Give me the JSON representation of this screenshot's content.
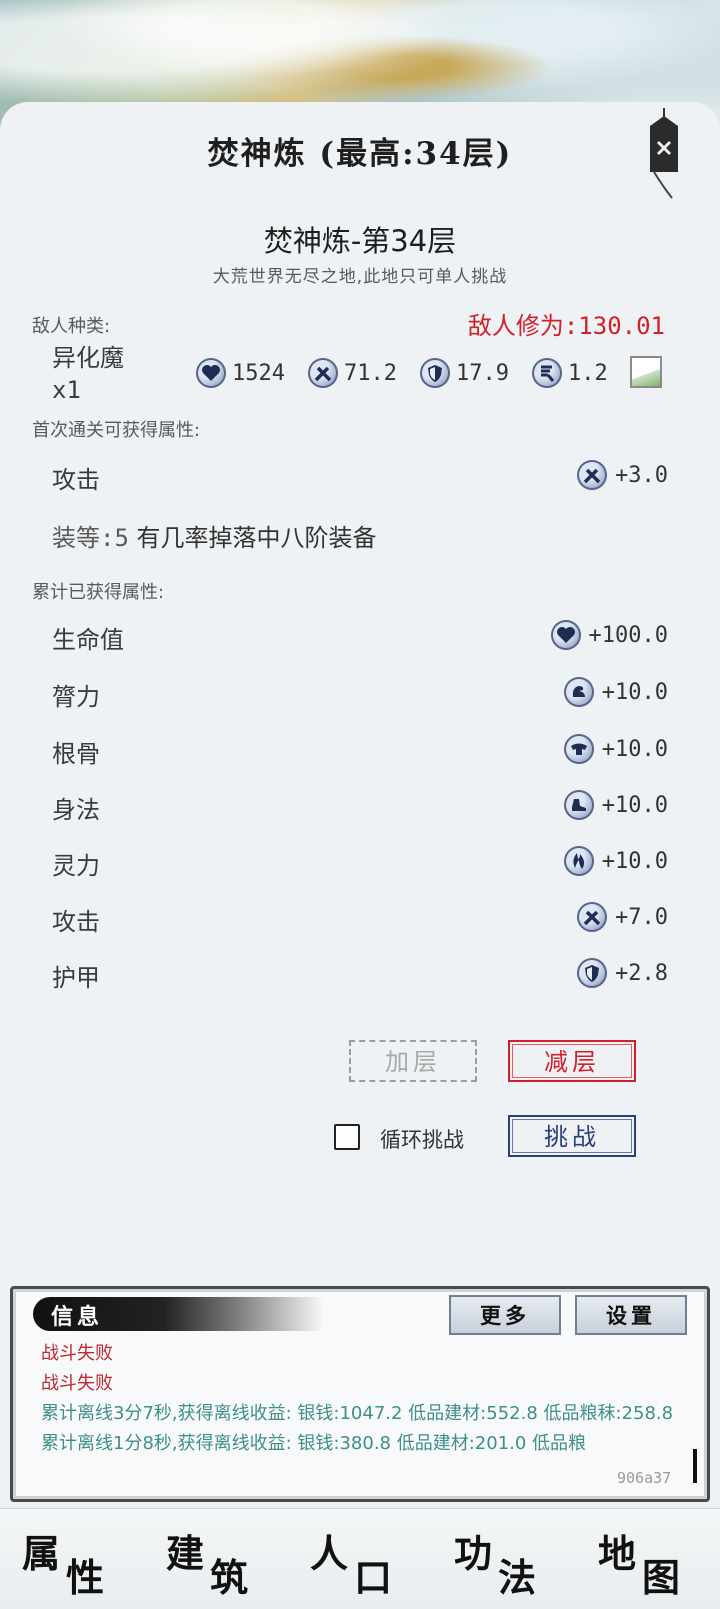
{
  "header": {
    "title": "焚神炼 (最高:34层)"
  },
  "stage": {
    "title": "焚神炼-第34层",
    "subtitle": "大荒世界无尽之地,此地只可单人挑战"
  },
  "enemy": {
    "type_label": "敌人种类:",
    "cultivation": "敌人修为:130.01",
    "name": "异化魔",
    "count": "x1",
    "stats": [
      {
        "icon": "heart-icon",
        "value": "1524"
      },
      {
        "icon": "sword-icon",
        "value": "71.2"
      },
      {
        "icon": "shield-icon",
        "value": "17.9"
      },
      {
        "icon": "boot-icon",
        "value": "1.2"
      }
    ]
  },
  "first_clear": {
    "label": "首次通关可获得属性:",
    "items": [
      {
        "name": "攻击",
        "icon": "sword-icon",
        "value": "+3.0"
      }
    ],
    "equip_key": "装等:5",
    "equip_text": "有几率掉落中八阶装备"
  },
  "accumulated": {
    "label": "累计已获得属性:",
    "items": [
      {
        "name": "生命值",
        "icon": "heart-icon",
        "value": "+100.0"
      },
      {
        "name": "膂力",
        "icon": "strength-icon",
        "value": "+10.0"
      },
      {
        "name": "根骨",
        "icon": "constitution-icon",
        "value": "+10.0"
      },
      {
        "name": "身法",
        "icon": "agility-icon",
        "value": "+10.0"
      },
      {
        "name": "灵力",
        "icon": "spirit-icon",
        "value": "+10.0"
      },
      {
        "name": "攻击",
        "icon": "sword-icon",
        "value": "+7.0"
      },
      {
        "name": "护甲",
        "icon": "shield-icon",
        "value": "+2.8"
      }
    ]
  },
  "actions": {
    "add_layer": "加层",
    "sub_layer": "减层",
    "loop_label": "循环挑战",
    "loop_checked": false,
    "challenge": "挑战"
  },
  "info": {
    "title": "信息",
    "more": "更多",
    "settings": "设置",
    "log": [
      {
        "cls": "red",
        "text": "战斗失败"
      },
      {
        "cls": "red",
        "text": "战斗失败"
      },
      {
        "cls": "teal",
        "text": "累计离线3分7秒,获得离线收益: 银钱:1047.2 低品建材:552.8 低品粮秣:258.8"
      },
      {
        "cls": "cut",
        "text": "累计离线1分8秒,获得离线收益: 银钱:380.8 低品建材:201.0 低品粮"
      }
    ],
    "version": "906a37"
  },
  "nav": [
    {
      "c1": "属",
      "c2": "性"
    },
    {
      "c1": "建",
      "c2": "筑"
    },
    {
      "c1": "人",
      "c2": "口"
    },
    {
      "c1": "功",
      "c2": "法"
    },
    {
      "c1": "地",
      "c2": "图"
    }
  ]
}
